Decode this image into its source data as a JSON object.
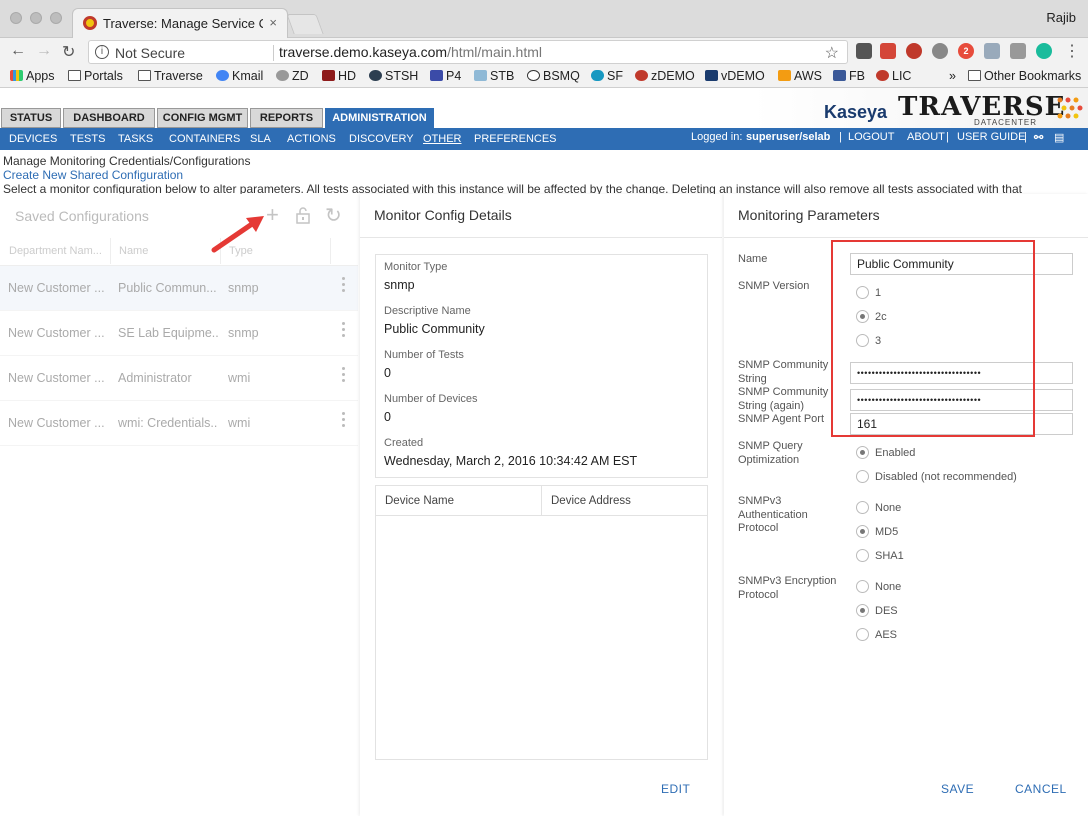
{
  "browser": {
    "tab_title": "Traverse: Manage Service Con",
    "tab_close": "×",
    "profile": "Rajib",
    "security_label": "Not Secure",
    "url_host": "traverse.demo.kaseya.com",
    "url_path": "/html/main.html",
    "back": "←",
    "forward": "→",
    "reload": "↻",
    "star": "☆",
    "info": "i",
    "menu": "⋮",
    "ext_badge": "2",
    "bookmarks": [
      "Apps",
      "Portals",
      "Traverse",
      "Kmail",
      "ZD",
      "HD",
      "STSH",
      "P4",
      "STB",
      "BSMQ",
      "SF",
      "zDEMO",
      "vDEMO",
      "AWS",
      "FB",
      "LIC"
    ],
    "bookmarks_more": "»",
    "other_bookmarks": "Other Bookmarks"
  },
  "app": {
    "main_tabs": [
      "STATUS",
      "DASHBOARD",
      "CONFIG MGMT",
      "REPORTS",
      "ADMINISTRATION"
    ],
    "sub_nav": [
      "DEVICES",
      "TESTS",
      "TASKS",
      "CONTAINERS",
      "SLA",
      "ACTIONS",
      "DISCOVERY",
      "OTHER",
      "PREFERENCES"
    ],
    "logged_in_label": "Logged in:",
    "logged_in_user": "superuser/selab",
    "logout": "LOGOUT",
    "about": "ABOUT",
    "user_guide": "USER GUIDE",
    "sep": "|",
    "logo_kaseya": "Kaseya",
    "logo_traverse": "TRAVERSE",
    "logo_datacenter": "DATACENTER"
  },
  "intro": {
    "heading": "Manage Monitoring Credentials/Configurations",
    "create_link": "Create New Shared Configuration",
    "description": "Select a monitor configuration below to alter parameters. All tests associated with this instance will be affected by the change. Deleting an instance will also remove all tests associated with that"
  },
  "saved_configs": {
    "title": "Saved Configurations",
    "icons": {
      "add": "+",
      "lock": "🔓",
      "refresh": "↻"
    },
    "columns": [
      "Department Nam...",
      "Name",
      "Type"
    ],
    "rows": [
      {
        "department": "New Customer ...",
        "name": "Public Commun...",
        "type": "snmp"
      },
      {
        "department": "New Customer ...",
        "name": "SE Lab Equipme...",
        "type": "snmp"
      },
      {
        "department": "New Customer ...",
        "name": "Administrator",
        "type": "wmi"
      },
      {
        "department": "New Customer ...",
        "name": "wmi: Credentials...",
        "type": "wmi"
      }
    ]
  },
  "details": {
    "title": "Monitor Config Details",
    "monitor_type_label": "Monitor Type",
    "monitor_type": "snmp",
    "desc_name_label": "Descriptive Name",
    "desc_name": "Public Community",
    "num_tests_label": "Number of Tests",
    "num_tests": "0",
    "num_devices_label": "Number of Devices",
    "num_devices": "0",
    "created_label": "Created",
    "created": "Wednesday, March 2, 2016 10:34:42 AM EST",
    "device_columns": [
      "Device Name",
      "Device Address"
    ],
    "edit": "EDIT"
  },
  "params": {
    "title": "Monitoring Parameters",
    "name_label": "Name",
    "name_value": "Public Community",
    "snmp_version_label": "SNMP Version",
    "snmp_versions": [
      "1",
      "2c",
      "3"
    ],
    "community_label": "SNMP Community String",
    "community_value": "••••••••••••••••••••••••••••••••••",
    "community_again_label": "SNMP Community String (again)",
    "community_again_value": "••••••••••••••••••••••••••••••••••",
    "agent_port_label": "SNMP Agent Port",
    "agent_port_value": "161",
    "query_opt_label": "SNMP Query Optimization",
    "query_opt_options": [
      "Enabled",
      "Disabled (not recommended)"
    ],
    "auth_label": "SNMPv3 Authentication Protocol",
    "auth_options": [
      "None",
      "MD5",
      "SHA1"
    ],
    "enc_label": "SNMPv3 Encryption Protocol",
    "enc_options": [
      "None",
      "DES",
      "AES"
    ],
    "save": "SAVE",
    "cancel": "CANCEL"
  },
  "colors": {
    "accent": "#2e6db4",
    "highlight": "#e53935"
  }
}
